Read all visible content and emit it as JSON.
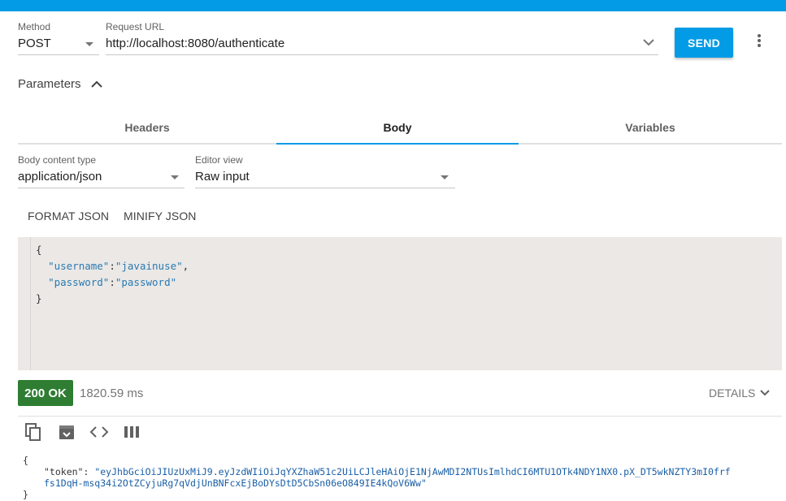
{
  "request": {
    "method_label": "Method",
    "method_value": "POST",
    "url_label": "Request URL",
    "url_value": "http://localhost:8080/authenticate",
    "send_label": "SEND"
  },
  "parameters": {
    "label": "Parameters"
  },
  "tabs": [
    {
      "label": "Headers",
      "active": false
    },
    {
      "label": "Body",
      "active": true
    },
    {
      "label": "Variables",
      "active": false
    }
  ],
  "body": {
    "content_type_label": "Body content type",
    "content_type_value": "application/json",
    "editor_view_label": "Editor view",
    "editor_view_value": "Raw input",
    "format_label": "FORMAT JSON",
    "minify_label": "MINIFY JSON",
    "lines": {
      "open": "{",
      "username_key": "\"username\"",
      "username_value": "\"javainuse\"",
      "password_key": "\"password\"",
      "password_value": "\"password\"",
      "close": "}"
    }
  },
  "response": {
    "status": "200 OK",
    "time": "1820.59 ms",
    "details_label": "DETAILS",
    "open": "{",
    "token_key": "\"token\"",
    "token_line1": "\"eyJhbGciOiJIUzUxMiJ9.eyJzdWIiOiJqYXZhaW51c2UiLCJleHAiOjE1NjAwMDI2NTUsImlhdCI6MTU1OTk4NDY1NX0.pX_DT5wkNZTY3mI0frf",
    "token_line2": "fs1DqH-msq34i2OtZCyjuRg7qVdjUnBNFcxEjBoDYsDtD5CbSn06eO849IE4kQoV6Ww\"",
    "close": "}"
  },
  "colors": {
    "accent": "#039be5",
    "success": "#2e7d32"
  }
}
